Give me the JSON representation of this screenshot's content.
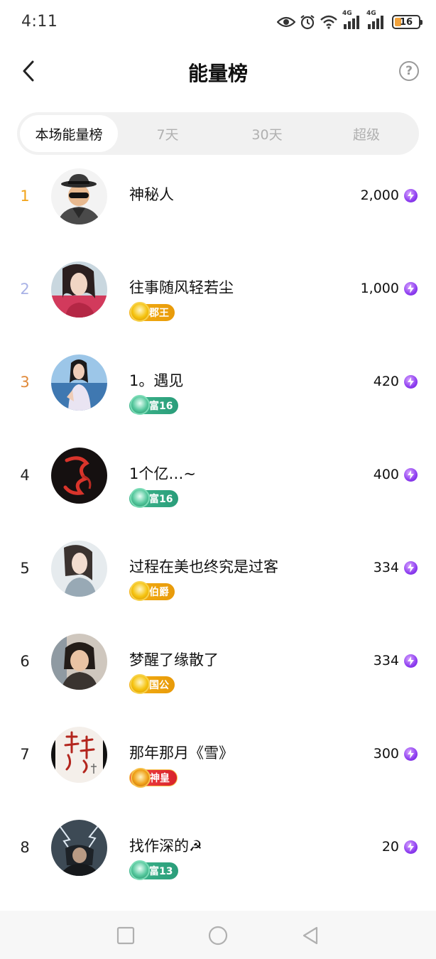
{
  "status_bar": {
    "time": "4:11",
    "network_1": "4G",
    "network_2": "4G",
    "battery": "16",
    "icons": [
      "eye-icon",
      "alarm-icon",
      "wifi-icon",
      "signal-icon",
      "signal-icon",
      "battery-icon"
    ]
  },
  "header": {
    "title": "能量榜",
    "back_icon": "chevron-left-icon",
    "help_label": "?"
  },
  "tabs": [
    {
      "label": "本场能量榜",
      "active": true
    },
    {
      "label": "7天",
      "active": false
    },
    {
      "label": "30天",
      "active": false
    },
    {
      "label": "超级",
      "active": false
    }
  ],
  "colors": {
    "rank_1": "#f2a318",
    "rank_2": "#a9b2e6",
    "rank_3": "#e0893a",
    "rank_default": "#222222",
    "energy_icon": "#8d3df0",
    "tab_bg": "#f1f1f1"
  },
  "ranking": [
    {
      "rank": "1",
      "name": "神秘人",
      "badge": null,
      "badge_style": null,
      "energy": "2,000"
    },
    {
      "rank": "2",
      "name": "往事随风轻若尘",
      "badge": "郡王",
      "badge_style": "gold",
      "energy": "1,000"
    },
    {
      "rank": "3",
      "name": "1。遇见",
      "badge": "富16",
      "badge_style": "green",
      "energy": "420"
    },
    {
      "rank": "4",
      "name": "1个亿…~",
      "badge": "富16",
      "badge_style": "green",
      "energy": "400"
    },
    {
      "rank": "5",
      "name": "过程在美也终究是过客",
      "badge": "伯爵",
      "badge_style": "gold",
      "energy": "334"
    },
    {
      "rank": "6",
      "name": "梦醒了缘散了",
      "badge": "国公",
      "badge_style": "gold",
      "energy": "334"
    },
    {
      "rank": "7",
      "name": "那年那月《雪》",
      "badge": "神皇",
      "badge_style": "red",
      "energy": "300"
    },
    {
      "rank": "8",
      "name": "找作深的☭",
      "badge": "富13",
      "badge_style": "green",
      "energy": "20"
    }
  ],
  "nav_bar": {
    "icons": [
      "square-recents-icon",
      "circle-home-icon",
      "triangle-back-icon"
    ]
  }
}
